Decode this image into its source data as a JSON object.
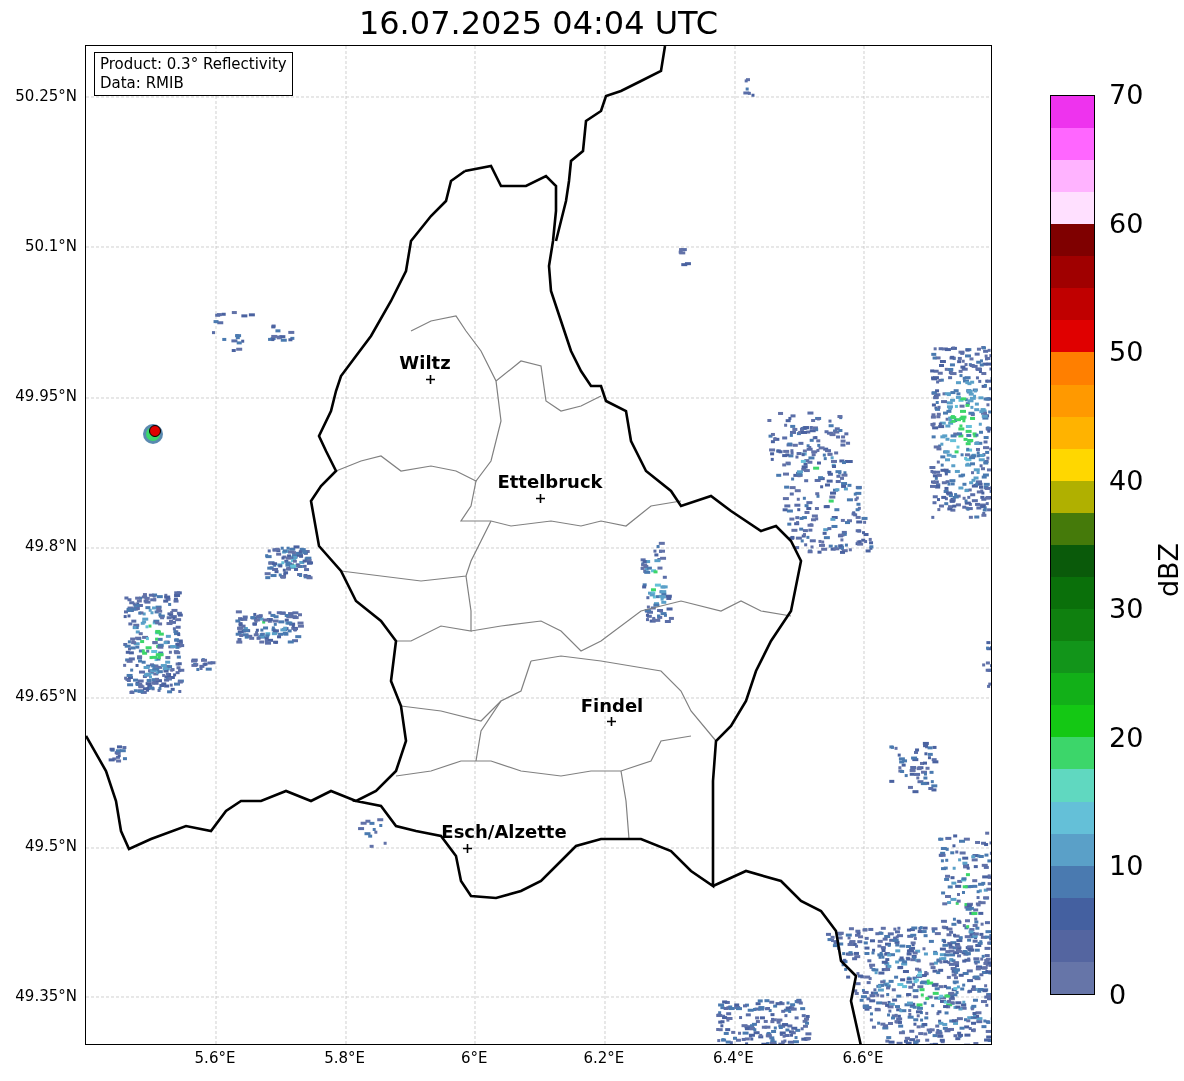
{
  "title": "16.07.2025 04:04 UTC",
  "info": [
    "Product: 0.3° Reflectivity",
    "Data: RMIB"
  ],
  "y_ticks": [
    "50.25°N",
    "50.1°N",
    "49.95°N",
    "49.8°N",
    "49.65°N",
    "49.5°N",
    "49.35°N"
  ],
  "x_ticks": [
    "5.6°E",
    "5.8°E",
    "6°E",
    "6.2°E",
    "6.4°E",
    "6.6°E"
  ],
  "cities": [
    {
      "name": "Wiltz"
    },
    {
      "name": "Ettelbruck"
    },
    {
      "name": "Findel"
    },
    {
      "name": "Esch/Alzette"
    }
  ],
  "colorbar": {
    "label": "dBZ",
    "ticks": [
      "70",
      "60",
      "50",
      "40",
      "30",
      "20",
      "10",
      "0"
    ],
    "segments": [
      {
        "color": "#6675a8"
      },
      {
        "color": "#5465a0"
      },
      {
        "color": "#4460a0"
      },
      {
        "color": "#4a7ab0"
      },
      {
        "color": "#5aa0c8"
      },
      {
        "color": "#64c0d8"
      },
      {
        "color": "#60d8c0"
      },
      {
        "color": "#3cd66a"
      },
      {
        "color": "#14c814"
      },
      {
        "color": "#12b018"
      },
      {
        "color": "#12951a"
      },
      {
        "color": "#0f800f"
      },
      {
        "color": "#0a700a"
      },
      {
        "color": "#0a5a0a"
      },
      {
        "color": "#457a0a"
      },
      {
        "color": "#b0b000"
      },
      {
        "color": "#ffd700"
      },
      {
        "color": "#ffb300"
      },
      {
        "color": "#ff9900"
      },
      {
        "color": "#ff7f00"
      },
      {
        "color": "#e00000"
      },
      {
        "color": "#c00000"
      },
      {
        "color": "#a00000"
      },
      {
        "color": "#7f0000"
      },
      {
        "color": "#ffe0ff"
      },
      {
        "color": "#ffb3ff"
      },
      {
        "color": "#ff66ff"
      },
      {
        "color": "#ee33ee"
      }
    ]
  }
}
